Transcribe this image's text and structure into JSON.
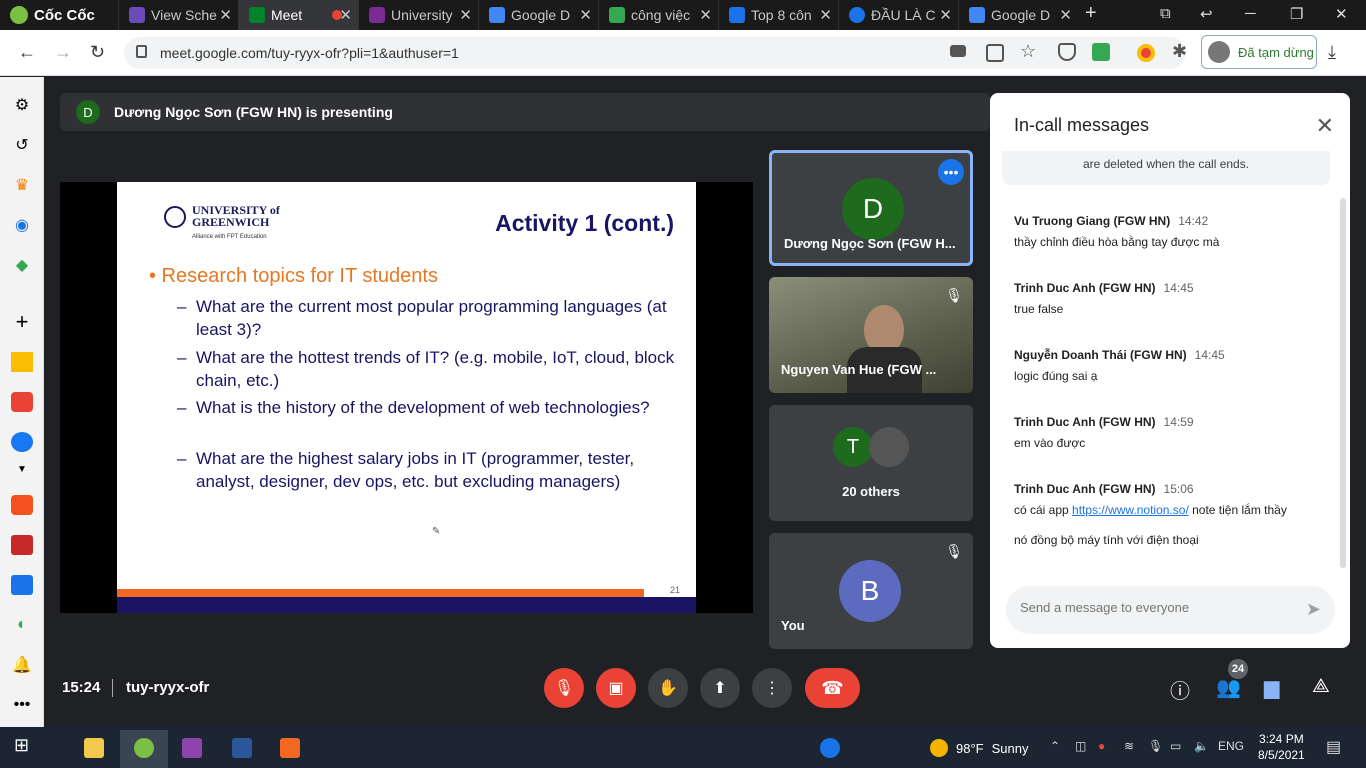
{
  "browser": {
    "brand": "Cốc Cốc",
    "tabs": [
      {
        "label": "View Sche",
        "fav": "#6b4bb7"
      },
      {
        "label": "Meet",
        "fav": "#00832d",
        "active": true
      },
      {
        "label": "University",
        "fav": "#7a2b94"
      },
      {
        "label": "Google D",
        "fav": "#4285f4"
      },
      {
        "label": "công việc",
        "fav": "#34a853"
      },
      {
        "label": "Top 8 côn",
        "fav": "#1a73e8"
      },
      {
        "label": "ĐẦU LÀ C",
        "fav": "#1a73e8"
      },
      {
        "label": "Google D",
        "fav": "#4285f4"
      }
    ],
    "new_tab": "+",
    "url": "meet.google.com/tuy-ryyx-ofr?pli=1&authuser=1",
    "paused_label": "Đã tạm dừng"
  },
  "meet": {
    "presenter_avatar": "D",
    "presenting_text": "Dương Ngọc Sơn (FGW HN) is presenting",
    "slide": {
      "logo_line1": "UNIVERSITY of",
      "logo_line2": "GREENWICH",
      "logo_sub": "Alliance with FPT Education",
      "title": "Activity 1 (cont.)",
      "bullet": "• Research topics for IT students",
      "items": [
        "What are the current most popular programming languages (at least 3)?",
        "What are the hottest trends of IT? (e.g. mobile, IoT, cloud, block chain, etc.)",
        "What is the history of the development of web technologies?",
        "What are the highest salary jobs in IT (programmer, tester, analyst, designer, dev ops, etc. but excluding managers)"
      ],
      "page_number": "21"
    },
    "tiles": [
      {
        "avatar": "D",
        "name": "Dương Ngọc Sơn (FGW H...",
        "color": "#1e6b1e"
      },
      {
        "name": "Nguyen Van Hue (FGW ..."
      },
      {
        "avatar": "T",
        "name": "20 others",
        "color": "#1e6b1e"
      },
      {
        "avatar": "B",
        "name": "You",
        "color": "#5c6bc0"
      }
    ],
    "chat": {
      "title": "In-call messages",
      "note": "are deleted when the call ends.",
      "messages": [
        {
          "sender": "Vu Truong Giang (FGW HN)",
          "time": "14:42",
          "text": "thầy chỉnh điều hòa bằng tay được mà"
        },
        {
          "sender": "Trinh Duc Anh (FGW HN)",
          "time": "14:45",
          "text": "true false"
        },
        {
          "sender": "Nguyễn Doanh Thái (FGW HN)",
          "time": "14:45",
          "text": "logic đúng sai ạ"
        },
        {
          "sender": "Trinh Duc Anh (FGW HN)",
          "time": "14:59",
          "text": "em vào được"
        },
        {
          "sender": "Trinh Duc Anh (FGW HN)",
          "time": "15:06",
          "text_prefix": "có cái app ",
          "link": "https://www.notion.so/",
          "text_suffix": " note tiện lắm thầy",
          "text2": "nó đồng bộ máy tính với điện thoại"
        }
      ],
      "placeholder": "Send a message to everyone"
    },
    "clock": "15:24",
    "meeting_code": "tuy-ryyx-ofr",
    "people_count": "24"
  },
  "taskbar": {
    "weather_temp": "98°F",
    "weather_desc": "Sunny",
    "lang": "ENG",
    "time": "3:24 PM",
    "date": "8/5/2021"
  }
}
